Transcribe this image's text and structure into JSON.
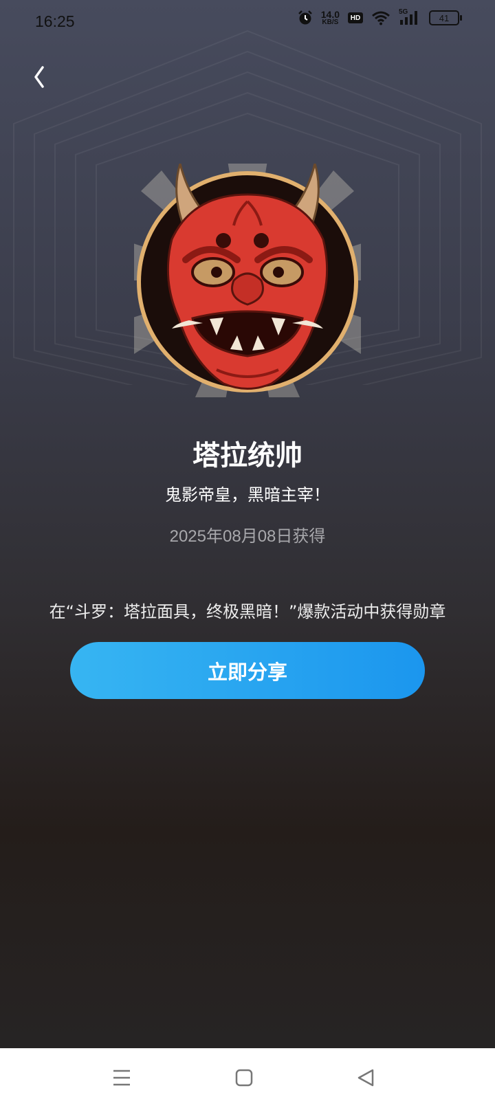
{
  "status_bar": {
    "time": "16:25",
    "net_speed": "14.0",
    "net_unit": "KB/S",
    "hd_label": "HD",
    "signal_label": "5G",
    "battery": "41",
    "icons": [
      "alarm-icon",
      "hd-icon",
      "wifi-icon",
      "signal-5g-icon",
      "battery-icon"
    ]
  },
  "header": {
    "back_icon": "chevron-left-icon"
  },
  "badge": {
    "name": "塔拉统帅",
    "motto": "鬼影帝皇，黑暗主宰！",
    "obtained_date": "2025年08月08日获得",
    "description": "在“斗罗：塔拉面具，终极黑暗！”爆款活动中获得勋章",
    "image": "red-oni-mask-medal",
    "ring_color": "#e1b06e",
    "mask_color": "#d93a30"
  },
  "share_button": {
    "label": "立即分享",
    "color_start": "#37b5f2",
    "color_end": "#1b96ee"
  },
  "nav_bar": {
    "icons": [
      "menu-icon",
      "home-square-icon",
      "back-triangle-icon"
    ]
  }
}
